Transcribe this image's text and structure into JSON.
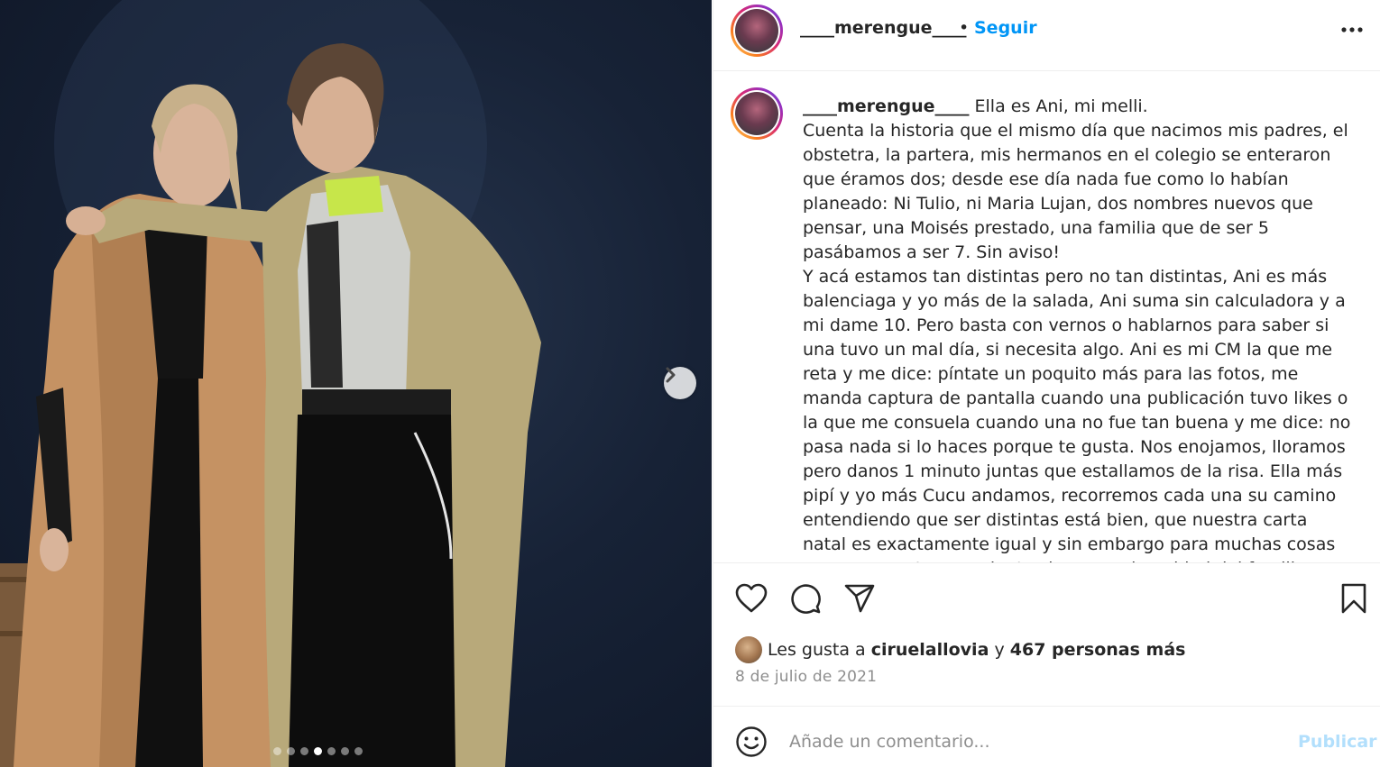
{
  "post": {
    "username": "____merengue____",
    "separator": "•",
    "follow_label": "Seguir",
    "more_icon": "more-horizontal-icon"
  },
  "photo": {
    "carousel_total": 7,
    "carousel_active_index": 3,
    "next_icon": "chevron-right-icon"
  },
  "caption": {
    "username": "____merengue____",
    "text": " Ella es Ani, mi melli.\nCuenta la historia que el mismo día que nacimos mis padres, el obstetra, la partera, mis hermanos en el colegio se enteraron que éramos dos; desde ese día nada fue como lo habían planeado: Ni Tulio, ni Maria Lujan, dos nombres nuevos que pensar, una Moisés prestado, una familia que de ser 5 pasábamos a ser 7. Sin aviso!\nY acá estamos tan distintas pero no tan distintas, Ani es más balenciaga y yo más de la salada, Ani suma sin calculadora y a mi dame 10. Pero basta con vernos o hablarnos para saber si una tuvo un mal día, si necesita algo. Ani es mi CM la que me reta y me dice: píntate un poquito más para las fotos, me manda captura de pantalla cuando una publicación tuvo likes o la que me consuela cuando una no fue tan buena y me dice: no pasa nada si lo haces porque te gusta. Nos enojamos, lloramos pero danos 1 minuto juntas que estallamos de la risa. Ella más pipí y yo más Cucu andamos, recorremos cada una su camino entendiendo que ser distintas está bien, que nuestra carta natal es exactamente igual y sin embargo para muchas cosas somos opuestas, que juntas hacemos la unidad del familia"
  },
  "actions": {
    "like_icon": "heart-icon",
    "comment_icon": "comment-bubble-icon",
    "share_icon": "paper-plane-icon",
    "save_icon": "bookmark-icon"
  },
  "likes": {
    "prefix": "Les gusta a",
    "user": "ciruelallovia",
    "connector": "y",
    "others": "467 personas más"
  },
  "date": "8 de julio de 2021",
  "comment": {
    "placeholder": "Añade un comentario...",
    "publish_label": "Publicar",
    "emoji_icon": "smiley-icon"
  },
  "colors": {
    "accent": "#0095f6",
    "publish_disabled": "#b2dffc",
    "text": "#262626",
    "muted": "#8e8e8e",
    "border": "#efefef"
  }
}
